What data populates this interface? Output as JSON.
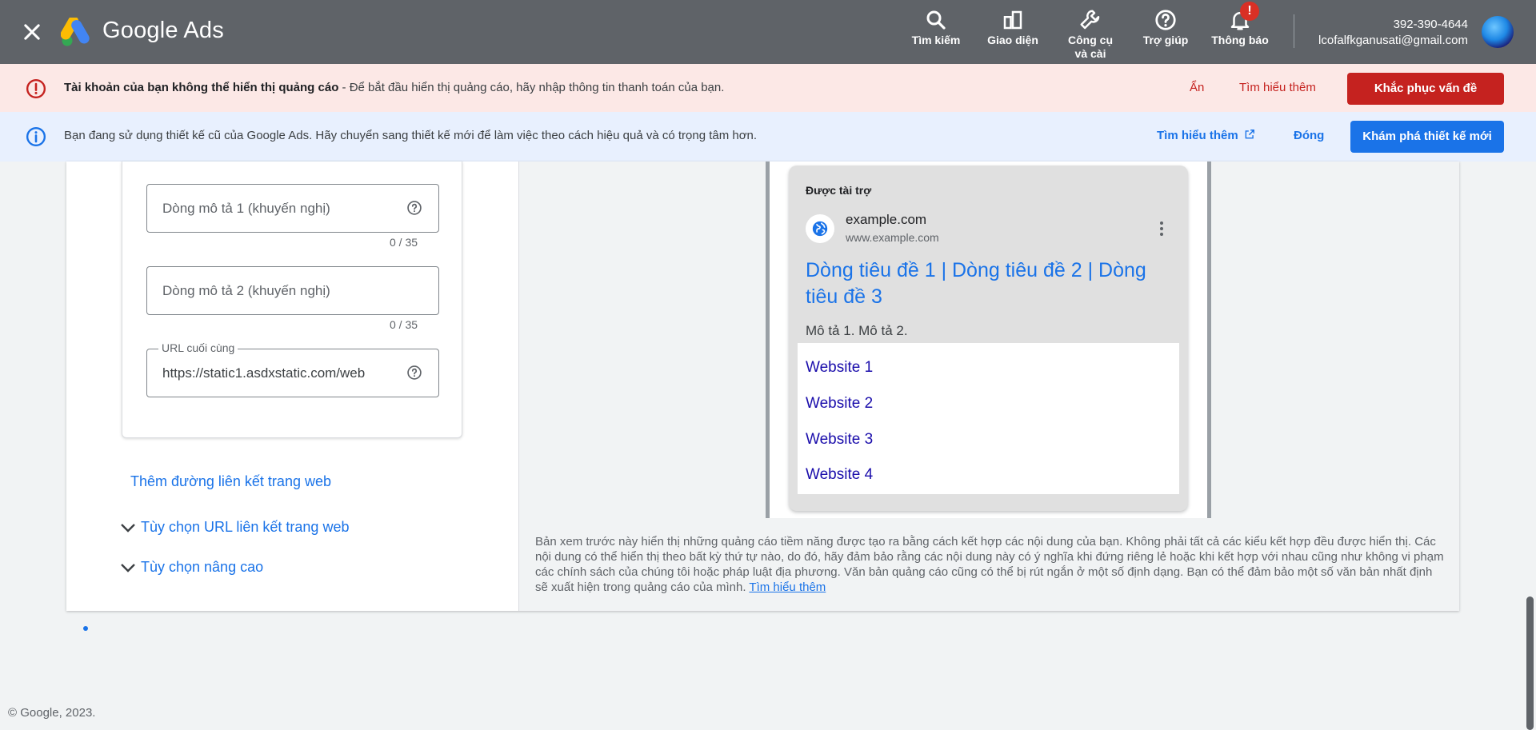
{
  "topbar": {
    "brand": "Google Ads",
    "nav": {
      "search": "Tìm kiếm",
      "appearance": "Giao diện",
      "tools": "Công cụ và cài",
      "help": "Trợ giúp",
      "notifications": "Thông báo"
    },
    "notification_badge": "!",
    "account_id": "392-390-4644",
    "account_email": "lcofalfkganusati@gmail.com"
  },
  "alert_banner": {
    "title": "Tài khoản của bạn không thể hiển thị quảng cáo",
    "message": " - Để bắt đầu hiển thị quảng cáo, hãy nhập thông tin thanh toán của bạn.",
    "hide": "Ẩn",
    "learn_more": "Tìm hiểu thêm",
    "fix": "Khắc phục vấn đề"
  },
  "info_banner": {
    "message": "Bạn đang sử dụng thiết kế cũ của Google Ads. Hãy chuyển sang thiết kế mới để làm việc theo cách hiệu quả và có trọng tâm hơn.",
    "learn_more": "Tìm hiểu thêm",
    "close": "Đóng",
    "explore": "Khám phá thiết kế mới"
  },
  "form": {
    "desc1_placeholder": "Dòng mô tả 1 (khuyến nghị)",
    "desc1_counter": "0 / 35",
    "desc2_placeholder": "Dòng mô tả 2 (khuyến nghị)",
    "desc2_counter": "0 / 35",
    "final_url_label": "URL cuối cùng",
    "final_url_value": "https://static1.asdxstatic.com/web",
    "add_sitelink": "Thêm đường liên kết trang web",
    "sitelink_url_options": "Tùy chọn URL liên kết trang web",
    "advanced_options": "Tùy chọn nâng cao"
  },
  "preview": {
    "sponsored": "Được tài trợ",
    "domain": "example.com",
    "url": "www.example.com",
    "headline": "Dòng tiêu đề 1 | Dòng tiêu đề 2 | Dòng tiêu đề 3",
    "description": "Mô tả 1. Mô tả 2.",
    "sitelinks": [
      "Website 1",
      "Website 2",
      "Website 3",
      "Website 4"
    ]
  },
  "disclaimer": {
    "text": "Bản xem trước này hiển thị những quảng cáo tiềm năng được tạo ra bằng cách kết hợp các nội dung của bạn. Không phải tất cả các kiểu kết hợp đều được hiển thị. Các nội dung có thể hiển thị theo bất kỳ thứ tự nào, do đó, hãy đảm bảo rằng các nội dung này có ý nghĩa khi đứng riêng lẻ hoặc khi kết hợp với nhau cũng như không vi phạm các chính sách của chúng tôi hoặc pháp luật địa phương. Văn bản quảng cáo cũng có thể bị rút ngắn ở một số định dạng. Bạn có thể đảm bảo một số văn bản nhất định sẽ xuất hiện trong quảng cáo của mình.",
    "learn_more": "Tìm hiểu thêm"
  },
  "footer": "© Google, 2023.",
  "colors": {
    "topbar": "#5f6368",
    "alert_bg": "#fce8e6",
    "alert_accent": "#c5221f",
    "info_bg": "#e8f0fe",
    "primary": "#1a73e8",
    "sitelink": "#1a0dab"
  },
  "icons": [
    "close-icon",
    "google-ads-logo",
    "search-icon",
    "appearance-icon",
    "wrench-icon",
    "help-icon",
    "bell-icon",
    "avatar",
    "error-icon",
    "info-icon",
    "open-in-new-icon",
    "help-circle-icon",
    "globe-icon",
    "kebab-icon",
    "chevron-down-icon"
  ]
}
